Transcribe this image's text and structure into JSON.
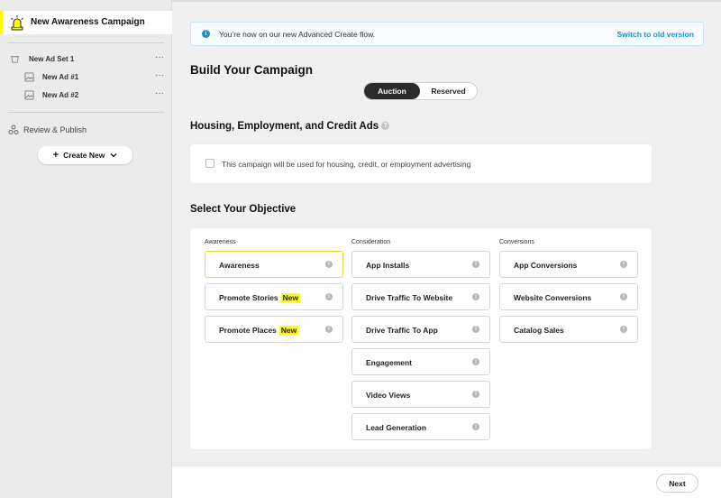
{
  "sidebar": {
    "campaign_label": "New Awareness Campaign",
    "ad_set_label": "New Ad Set 1",
    "ads": [
      {
        "label": "New Ad #1"
      },
      {
        "label": "New Ad #2"
      }
    ],
    "more_symbol": "···",
    "review_label": "Review & Publish",
    "create_new_label": "Create New",
    "create_new_plus": "+",
    "create_new_chevron": "⌄"
  },
  "notice": {
    "text": "You’re now on our new Advanced Create flow.",
    "link": "Switch to old version",
    "icon": "i"
  },
  "build": {
    "title": "Build Your Campaign",
    "toggle": [
      "Auction",
      "Reserved"
    ],
    "selected": "Auction"
  },
  "housing": {
    "title": "Housing, Employment, and Credit Ads",
    "checkbox_label": "This campaign will be used for housing, credit, or employment advertising",
    "checked": false
  },
  "objective": {
    "title": "Select Your Objective",
    "columns": [
      {
        "heading": "Awareness",
        "items": [
          {
            "label": "Awareness",
            "badge": "",
            "selected": true
          },
          {
            "label": "Promote Stories",
            "badge": "New"
          },
          {
            "label": "Promote Places",
            "badge": "New"
          }
        ]
      },
      {
        "heading": "Consideration",
        "items": [
          {
            "label": "App Installs",
            "badge": ""
          },
          {
            "label": "Drive Traffic To Website",
            "badge": ""
          },
          {
            "label": "Drive Traffic To App",
            "badge": ""
          },
          {
            "label": "Engagement",
            "badge": ""
          },
          {
            "label": "Video Views",
            "badge": ""
          },
          {
            "label": "Lead Generation",
            "badge": ""
          }
        ]
      },
      {
        "heading": "Conversions",
        "items": [
          {
            "label": "App Conversions",
            "badge": ""
          },
          {
            "label": "Website Conversions",
            "badge": ""
          },
          {
            "label": "Catalog Sales",
            "badge": ""
          }
        ]
      }
    ],
    "info_glyph": "i"
  },
  "footer": {
    "next_label": "Next"
  },
  "colors": {
    "accent_yellow": "#fffc00",
    "link_blue": "#1d8fd1",
    "selected_border": "#f2d22a"
  }
}
